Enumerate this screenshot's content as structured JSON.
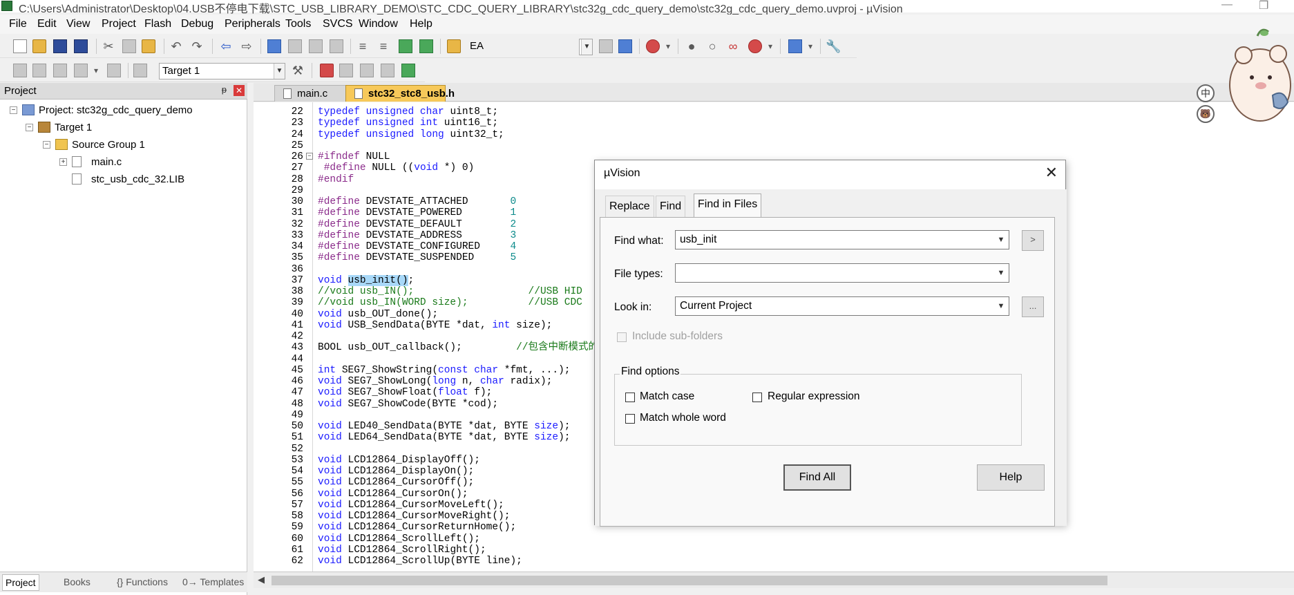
{
  "window": {
    "title": "C:\\Users\\Administrator\\Desktop\\04.USB不停电下载\\STC_USB_LIBRARY_DEMO\\STC_CDC_QUERY_LIBRARY\\stc32g_cdc_query_demo\\stc32g_cdc_query_demo.uvproj - µVision"
  },
  "menu": [
    "File",
    "Edit",
    "View",
    "Project",
    "Flash",
    "Debug",
    "Peripherals",
    "Tools",
    "SVCS",
    "Window",
    "Help"
  ],
  "toolbar": {
    "find_combo": "EA",
    "target_combo": "Target 1"
  },
  "project_panel": {
    "title": "Project",
    "pin": "ᵽ",
    "close": "✕",
    "tree": {
      "project": "Project: stc32g_cdc_query_demo",
      "target": "Target 1",
      "group": "Source Group 1",
      "file1": "main.c",
      "file2": "stc_usb_cdc_32.LIB"
    },
    "tabs": [
      "Project",
      "Books",
      "{} Functions",
      "0→ Templates"
    ]
  },
  "editor": {
    "tabs": [
      "main.c",
      "stc32_stc8_usb.h"
    ],
    "lines": [
      {
        "n": "22",
        "parts": [
          [
            "kw",
            "typedef unsigned char "
          ],
          [
            "",
            "uint8_t;"
          ]
        ]
      },
      {
        "n": "23",
        "parts": [
          [
            "kw",
            "typedef unsigned int "
          ],
          [
            "",
            "uint16_t;"
          ]
        ]
      },
      {
        "n": "24",
        "parts": [
          [
            "kw",
            "typedef unsigned long "
          ],
          [
            "",
            "uint32_t;"
          ]
        ]
      },
      {
        "n": "25",
        "parts": []
      },
      {
        "n": "26",
        "fold": "⊟",
        "parts": [
          [
            "pp",
            "#ifndef "
          ],
          [
            "",
            "NULL"
          ]
        ]
      },
      {
        "n": "27",
        "parts": [
          [
            "pp",
            " #define "
          ],
          [
            "",
            "NULL (("
          ],
          [
            "kw",
            "void"
          ],
          [
            "",
            " *) 0)"
          ]
        ]
      },
      {
        "n": "28",
        "parts": [
          [
            "pp",
            "#endif"
          ]
        ]
      },
      {
        "n": "29",
        "parts": []
      },
      {
        "n": "30",
        "parts": [
          [
            "pp",
            "#define "
          ],
          [
            "",
            "DEVSTATE_ATTACHED       "
          ],
          [
            "num",
            "0"
          ]
        ]
      },
      {
        "n": "31",
        "parts": [
          [
            "pp",
            "#define "
          ],
          [
            "",
            "DEVSTATE_POWERED        "
          ],
          [
            "num",
            "1"
          ]
        ]
      },
      {
        "n": "32",
        "parts": [
          [
            "pp",
            "#define "
          ],
          [
            "",
            "DEVSTATE_DEFAULT        "
          ],
          [
            "num",
            "2"
          ]
        ]
      },
      {
        "n": "33",
        "parts": [
          [
            "pp",
            "#define "
          ],
          [
            "",
            "DEVSTATE_ADDRESS        "
          ],
          [
            "num",
            "3"
          ]
        ]
      },
      {
        "n": "34",
        "parts": [
          [
            "pp",
            "#define "
          ],
          [
            "",
            "DEVSTATE_CONFIGURED     "
          ],
          [
            "num",
            "4"
          ]
        ]
      },
      {
        "n": "35",
        "parts": [
          [
            "pp",
            "#define "
          ],
          [
            "",
            "DEVSTATE_SUSPENDED      "
          ],
          [
            "num",
            "5"
          ]
        ]
      },
      {
        "n": "36",
        "parts": []
      },
      {
        "n": "37",
        "parts": [
          [
            "kw",
            "void "
          ],
          [
            "hl",
            "usb_init()"
          ],
          [
            "",
            ";"
          ]
        ]
      },
      {
        "n": "38",
        "parts": [
          [
            "cm",
            "//void usb_IN();                   //USB HID"
          ]
        ]
      },
      {
        "n": "39",
        "parts": [
          [
            "cm",
            "//void usb_IN(WORD size);          //USB CDC"
          ]
        ]
      },
      {
        "n": "40",
        "parts": [
          [
            "kw",
            "void "
          ],
          [
            "",
            "usb_OUT_done();"
          ]
        ]
      },
      {
        "n": "41",
        "parts": [
          [
            "kw",
            "void "
          ],
          [
            "",
            "USB_SendData(BYTE *dat, "
          ],
          [
            "kw",
            "int "
          ],
          [
            "",
            "size);"
          ]
        ]
      },
      {
        "n": "42",
        "parts": []
      },
      {
        "n": "43",
        "parts": [
          [
            "",
            "BOOL usb_OUT_callback();         "
          ],
          [
            "cm",
            "//包含中断模式的"
          ]
        ]
      },
      {
        "n": "44",
        "parts": []
      },
      {
        "n": "45",
        "parts": [
          [
            "kw",
            "int "
          ],
          [
            "",
            "SEG7_ShowString("
          ],
          [
            "kw",
            "const char "
          ],
          [
            "",
            "*fmt, ...);"
          ]
        ]
      },
      {
        "n": "46",
        "parts": [
          [
            "kw",
            "void "
          ],
          [
            "",
            "SEG7_ShowLong("
          ],
          [
            "kw",
            "long "
          ],
          [
            "",
            "n, "
          ],
          [
            "kw",
            "char "
          ],
          [
            "",
            "radix);"
          ]
        ]
      },
      {
        "n": "47",
        "parts": [
          [
            "kw",
            "void "
          ],
          [
            "",
            "SEG7_ShowFloat("
          ],
          [
            "kw",
            "float "
          ],
          [
            "",
            "f);"
          ]
        ]
      },
      {
        "n": "48",
        "parts": [
          [
            "kw",
            "void "
          ],
          [
            "",
            "SEG7_ShowCode(BYTE *cod);"
          ]
        ]
      },
      {
        "n": "49",
        "parts": []
      },
      {
        "n": "50",
        "parts": [
          [
            "kw",
            "void "
          ],
          [
            "",
            "LED40_SendData(BYTE *dat, BYTE "
          ],
          [
            "kw",
            "size"
          ],
          [
            "",
            ");"
          ]
        ]
      },
      {
        "n": "51",
        "parts": [
          [
            "kw",
            "void "
          ],
          [
            "",
            "LED64_SendData(BYTE *dat, BYTE "
          ],
          [
            "kw",
            "size"
          ],
          [
            "",
            ");"
          ]
        ]
      },
      {
        "n": "52",
        "parts": []
      },
      {
        "n": "53",
        "parts": [
          [
            "kw",
            "void "
          ],
          [
            "",
            "LCD12864_DisplayOff();"
          ]
        ]
      },
      {
        "n": "54",
        "parts": [
          [
            "kw",
            "void "
          ],
          [
            "",
            "LCD12864_DisplayOn();"
          ]
        ]
      },
      {
        "n": "55",
        "parts": [
          [
            "kw",
            "void "
          ],
          [
            "",
            "LCD12864_CursorOff();"
          ]
        ]
      },
      {
        "n": "56",
        "parts": [
          [
            "kw",
            "void "
          ],
          [
            "",
            "LCD12864_CursorOn();"
          ]
        ]
      },
      {
        "n": "57",
        "parts": [
          [
            "kw",
            "void "
          ],
          [
            "",
            "LCD12864_CursorMoveLeft();"
          ]
        ]
      },
      {
        "n": "58",
        "parts": [
          [
            "kw",
            "void "
          ],
          [
            "",
            "LCD12864_CursorMoveRight();"
          ]
        ]
      },
      {
        "n": "59",
        "parts": [
          [
            "kw",
            "void "
          ],
          [
            "",
            "LCD12864_CursorReturnHome();"
          ]
        ]
      },
      {
        "n": "60",
        "parts": [
          [
            "kw",
            "void "
          ],
          [
            "",
            "LCD12864_ScrollLeft();"
          ]
        ]
      },
      {
        "n": "61",
        "parts": [
          [
            "kw",
            "void "
          ],
          [
            "",
            "LCD12864_ScrollRight();"
          ]
        ]
      },
      {
        "n": "62",
        "parts": [
          [
            "kw",
            "void "
          ],
          [
            "",
            "LCD12864_ScrollUp(BYTE line);"
          ]
        ]
      }
    ]
  },
  "ime": {
    "lang": "中",
    "skin": "🐻"
  },
  "dialog": {
    "title": "µVision",
    "close": "✕",
    "tabs": [
      "Replace",
      "Find",
      "Find in Files"
    ],
    "find_what_label": "Find what:",
    "find_what_value": "usb_init",
    "file_types_label": "File types:",
    "file_types_value": "",
    "look_in_label": "Look in:",
    "look_in_value": "Current Project",
    "find_next_glyph": ">",
    "browse_glyph": "...",
    "include_subfolders": "Include sub-folders",
    "find_options_label": "Find options",
    "match_case": "Match case",
    "regular_expression": "Regular expression",
    "match_whole_word": "Match whole word",
    "find_all": "Find All",
    "help": "Help"
  }
}
